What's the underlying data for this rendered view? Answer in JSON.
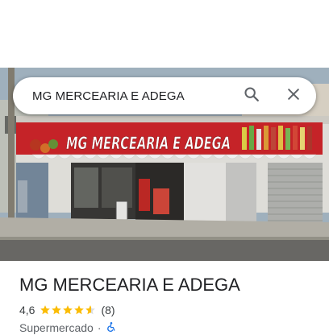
{
  "search": {
    "query": "MG MERCEARIA E ADEGA",
    "search_icon": "search-icon",
    "close_icon": "close-icon"
  },
  "photo": {
    "sign_text": "MG MERCEARIA E ADEGA",
    "sign_color": "#d2262b",
    "sign_text_color": "#ffffff"
  },
  "place": {
    "name": "MG MERCEARIA E ADEGA",
    "rating": "4,6",
    "rating_value": 4.6,
    "stars_total": 5,
    "review_count": "(8)",
    "category": "Supermercado",
    "separator": "·",
    "accessibility_icon": "wheelchair-icon"
  },
  "colors": {
    "star": "#fbbc04",
    "accessibility": "#1a73e8",
    "text": "#202124"
  }
}
